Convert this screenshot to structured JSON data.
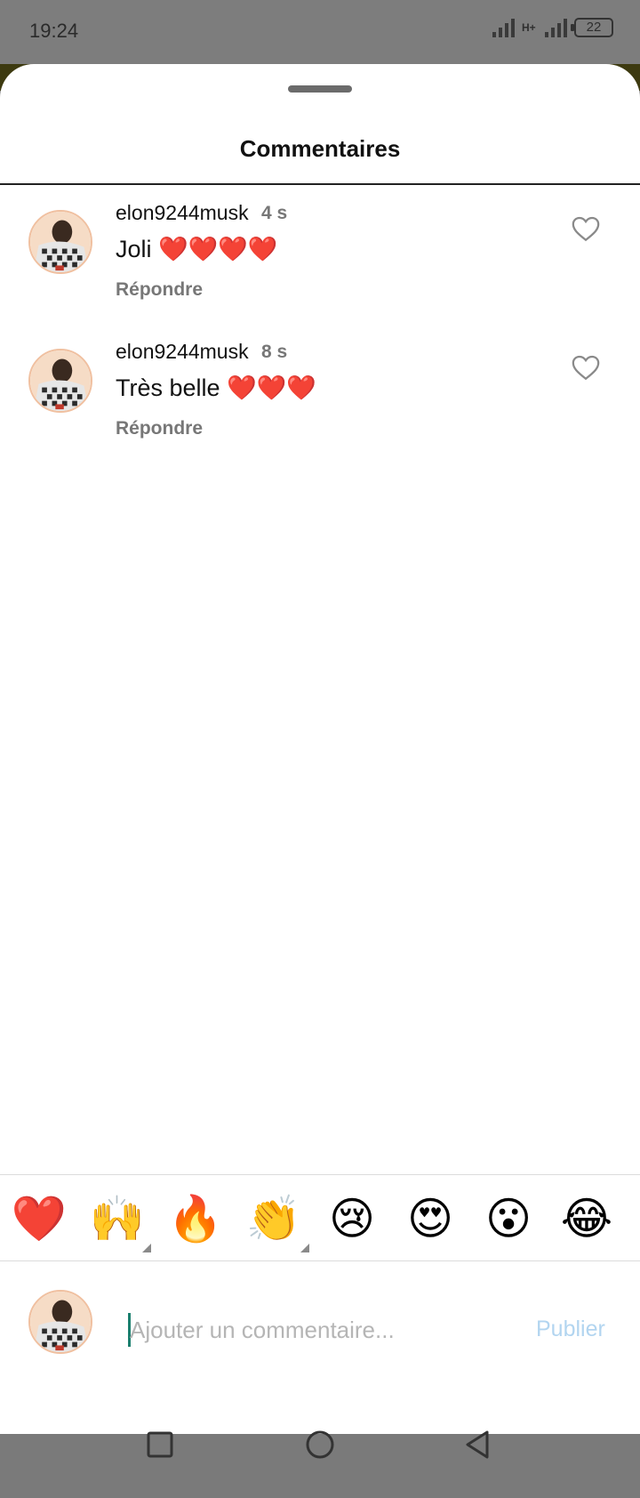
{
  "status_bar": {
    "time": "19:24",
    "network": "H+",
    "battery": "22"
  },
  "sheet": {
    "title": "Commentaires"
  },
  "comments": [
    {
      "username": "elon9244musk",
      "time": "4 s",
      "text": "Joli ❤️❤️❤️❤️",
      "reply_label": "Répondre",
      "like_icon": "heart-outline-icon"
    },
    {
      "username": "elon9244musk",
      "time": "8 s",
      "text": "Très belle ❤️❤️❤️",
      "reply_label": "Répondre",
      "like_icon": "heart-outline-icon"
    }
  ],
  "emoji_bar": [
    "❤️",
    "🙌",
    "🔥",
    "👏",
    "😢",
    "😍",
    "😮",
    "😂"
  ],
  "composer": {
    "placeholder": "Ajouter un commentaire...",
    "publish_label": "Publier",
    "publish_color": "#b2d5f0"
  },
  "nav_bar": {
    "icons": [
      "square-recents-icon",
      "circle-home-icon",
      "triangle-back-icon"
    ]
  }
}
